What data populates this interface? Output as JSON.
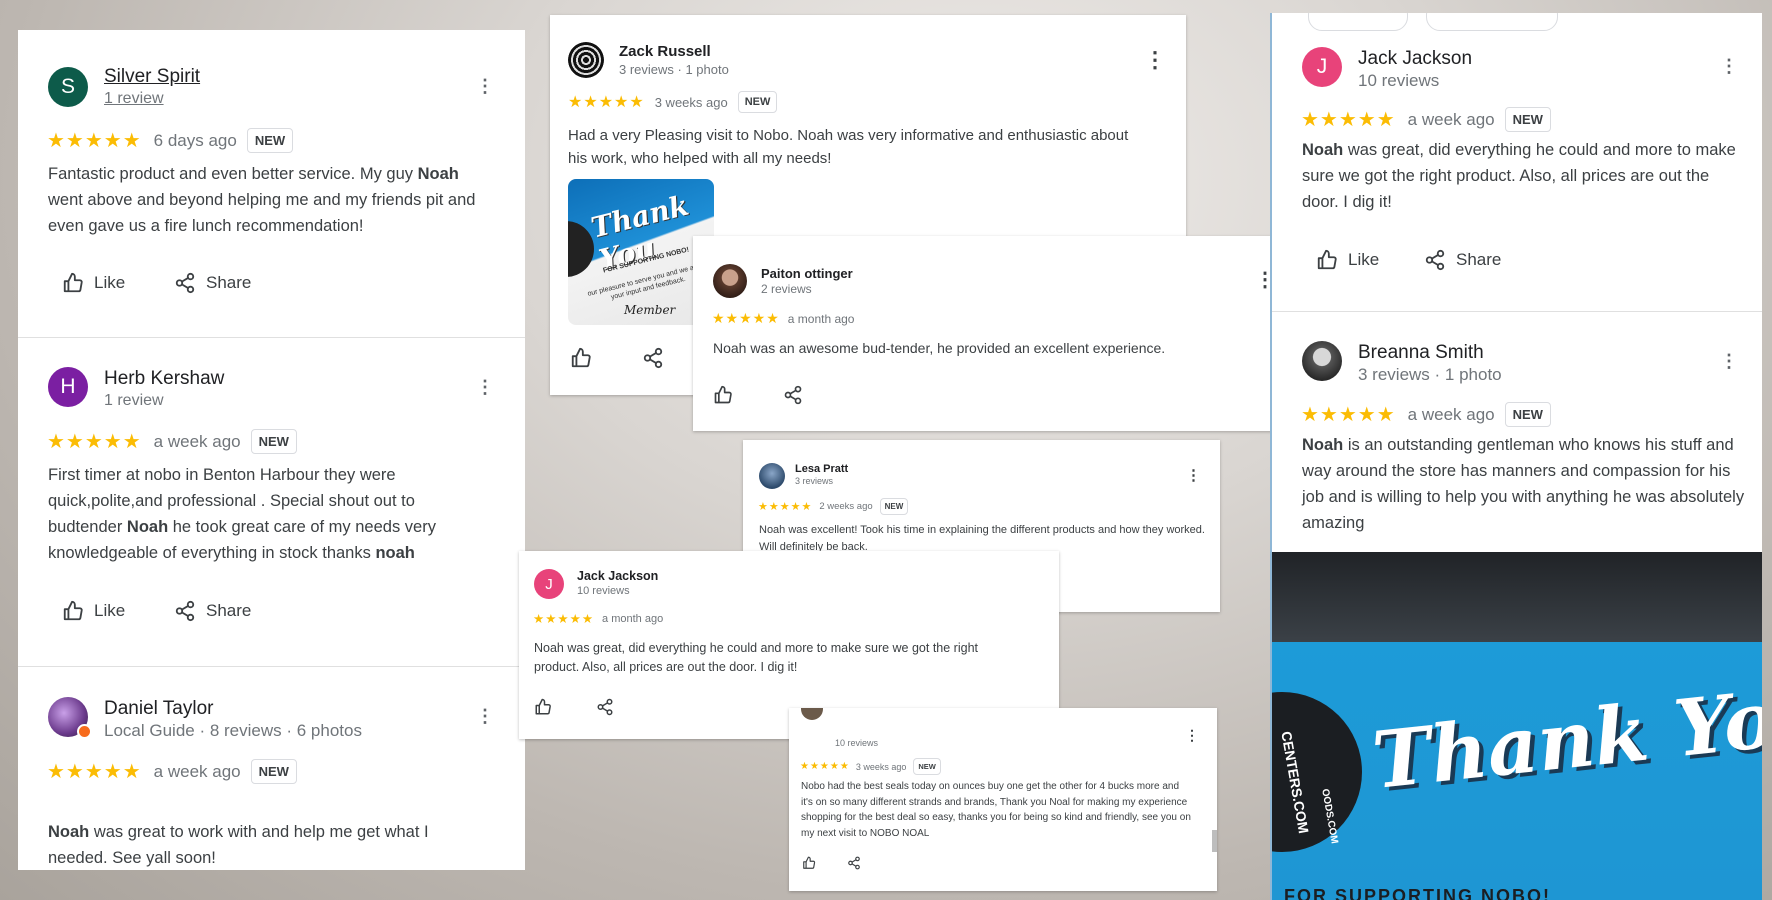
{
  "left_panel": {
    "reviews": [
      {
        "avatar_letter": "S",
        "avatar_color": "#0d5b4a",
        "name": "Silver Spirit",
        "meta": "1 review",
        "stars": "★★★★★",
        "time": "6 days ago",
        "badge": "NEW",
        "text_1": "Fantastic product and even better service. My guy ",
        "bold_1": "Noah",
        "text_2": " went above and beyond helping me and my friends pit and even gave us a fire lunch recommendation!",
        "like": "Like",
        "share": "Share"
      },
      {
        "avatar_letter": "H",
        "avatar_color": "#7b1fa2",
        "name": "Herb Kershaw",
        "meta": "1 review",
        "stars": "★★★★★",
        "time": "a week ago",
        "badge": "NEW",
        "text_1": "First timer at  nobo in Benton Harbour they were quick,polite,and professional . Special shout out to budtender ",
        "bold_1": "Noah",
        "text_2": " he took great care of my needs  very knowledgeable of everything in stock thanks ",
        "bold_2": "noah",
        "like": "Like",
        "share": "Share"
      },
      {
        "name": "Daniel Taylor",
        "meta": "Local Guide · 8 reviews · 6 photos",
        "stars": "★★★★★",
        "time": "a week ago",
        "badge": "NEW",
        "bold_1": "Noah",
        "text_1": " was great to work with and help me get what I needed. See yall soon!"
      }
    ]
  },
  "zack": {
    "name": "Zack Russell",
    "meta": "3 reviews · 1 photo",
    "stars": "★★★★★",
    "time": "3 weeks ago",
    "badge": "NEW",
    "text": "Had a very Pleasing visit to Nobo. Noah was very informative and enthusiastic about his work, who helped with all my needs!",
    "photo_title": "Thank You",
    "photo_sub_1": "FOR SUPPORTING NOBO!",
    "photo_sub_2": "our pleasure to serve you and we are",
    "photo_sub_3": "your input and feedback.",
    "photo_sign": "Member"
  },
  "paiton": {
    "name": "Paiton ottinger",
    "meta": "2 reviews",
    "stars": "★★★★★",
    "time": "a month ago",
    "text": "Noah was an awesome bud-tender, he provided an excellent experience."
  },
  "lesa": {
    "name": "Lesa Pratt",
    "meta": "3 reviews",
    "stars": "★★★★★",
    "time": "2 weeks ago",
    "badge": "NEW",
    "text": "Noah was excellent! Took his time in explaining the different products and how they worked. Will definitely be back."
  },
  "jack_small": {
    "avatar_letter": "J",
    "avatar_color": "#e8437a",
    "name": "Jack Jackson",
    "meta": "10 reviews",
    "stars": "★★★★★",
    "time": "a month ago",
    "text": "Noah was great, did everything he could and more to make sure we got the right product. Also, all prices are out the door. I dig it!"
  },
  "nobo_deal": {
    "meta": "10 reviews",
    "stars": "★★★★★",
    "time": "3 weeks ago",
    "badge": "NEW",
    "text": "Nobo had the best seals today on ounces buy one get the other for 4 bucks more and it's on so many different strands and brands, Thank you Noal for making my experience shopping for the best deal so easy, thanks you for being so kind and friendly, see you on my next visit to NOBO NOAL"
  },
  "right_panel": {
    "jack": {
      "avatar_letter": "J",
      "avatar_color": "#e8437a",
      "name": "Jack Jackson",
      "meta": "10 reviews",
      "stars": "★★★★★",
      "time": "a week ago",
      "badge": "NEW",
      "bold_1": "Noah",
      "text_1": " was great, did everything he could and more to make sure we got the right product. Also, all prices are out the door. I dig it!",
      "like": "Like",
      "share": "Share"
    },
    "breanna": {
      "name": "Breanna Smith",
      "meta": "3 reviews · 1 photo",
      "stars": "★★★★★",
      "time": "a week ago",
      "badge": "NEW",
      "bold_1": "Noah",
      "text_1": " is an outstanding gentleman who knows his stuff and way around the store has manners and compassion for his job and is willing to help you with anything he was absolutely amazing"
    },
    "photo": {
      "title": "Thank You",
      "side": "CENTERS.COM",
      "side_2": "OODS.COM",
      "bottom": "FOR SUPPORTING NOBO!"
    }
  },
  "colors": {
    "star": "#fbbc04",
    "accent_blue": "#1e8fd6"
  }
}
